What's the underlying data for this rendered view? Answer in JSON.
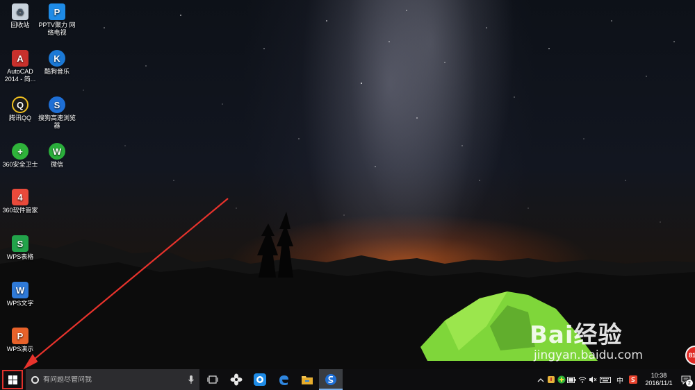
{
  "desktop": {
    "icons": [
      {
        "label": "回收站",
        "icon": "recycle-bin-icon",
        "color": "#c8d2dc"
      },
      {
        "label": "PPTV聚力 网络电视",
        "icon": "pptv-icon",
        "color": "#1e8be6"
      },
      {
        "label": "AutoCAD 2014 - 简...",
        "icon": "autocad-icon",
        "color": "#c8302c"
      },
      {
        "label": "酷狗音乐",
        "icon": "kugou-icon",
        "color": "#1b79d6"
      },
      {
        "label": "腾讯QQ",
        "icon": "qq-penguin-icon",
        "color": "#1a1a1a"
      },
      {
        "label": "搜狗高速浏览器",
        "icon": "sogou-browser-icon",
        "color": "#1e6fd6"
      },
      {
        "label": "360安全卫士",
        "icon": "360-security-icon",
        "color": "#2fb33a"
      },
      {
        "label": "微信",
        "icon": "wechat-icon",
        "color": "#2aae3b"
      },
      {
        "label": "360软件管家",
        "icon": "360-software-icon",
        "color": "#e94a3b"
      },
      {
        "label": "WPS表格",
        "icon": "wps-sheets-icon",
        "color": "#22a34a"
      },
      {
        "label": "WPS文字",
        "icon": "wps-writer-icon",
        "color": "#2f7ad8"
      },
      {
        "label": "WPS演示",
        "icon": "wps-presentation-icon",
        "color": "#e8622a"
      }
    ],
    "icon_glyphs": [
      "♻",
      "P",
      "A",
      "K",
      "Q",
      "S",
      "+",
      "W",
      "4",
      "S",
      "W",
      "P"
    ]
  },
  "watermark": {
    "brand": "Bai经验",
    "url": "jingyan.baidu.com"
  },
  "notification_badge": "81",
  "taskbar": {
    "search_placeholder": "有问题尽管问我",
    "pinned": [
      {
        "name": "task-view",
        "icon": "task-view-icon"
      },
      {
        "name": "fan-app",
        "icon": "fan-icon"
      },
      {
        "name": "pptv",
        "icon": "pptv-icon"
      },
      {
        "name": "edge",
        "icon": "edge-icon"
      },
      {
        "name": "file-explorer",
        "icon": "folder-icon"
      },
      {
        "name": "sogou-browser",
        "icon": "sogou-browser-icon",
        "active": true
      }
    ],
    "tray": {
      "ime": "中",
      "time": "10:38",
      "date": "2016/11/1",
      "notifications": "2"
    }
  },
  "colors": {
    "start_highlight": "#e0312b",
    "arrow": "#e8332c",
    "active_underline": "#7aaee8"
  }
}
